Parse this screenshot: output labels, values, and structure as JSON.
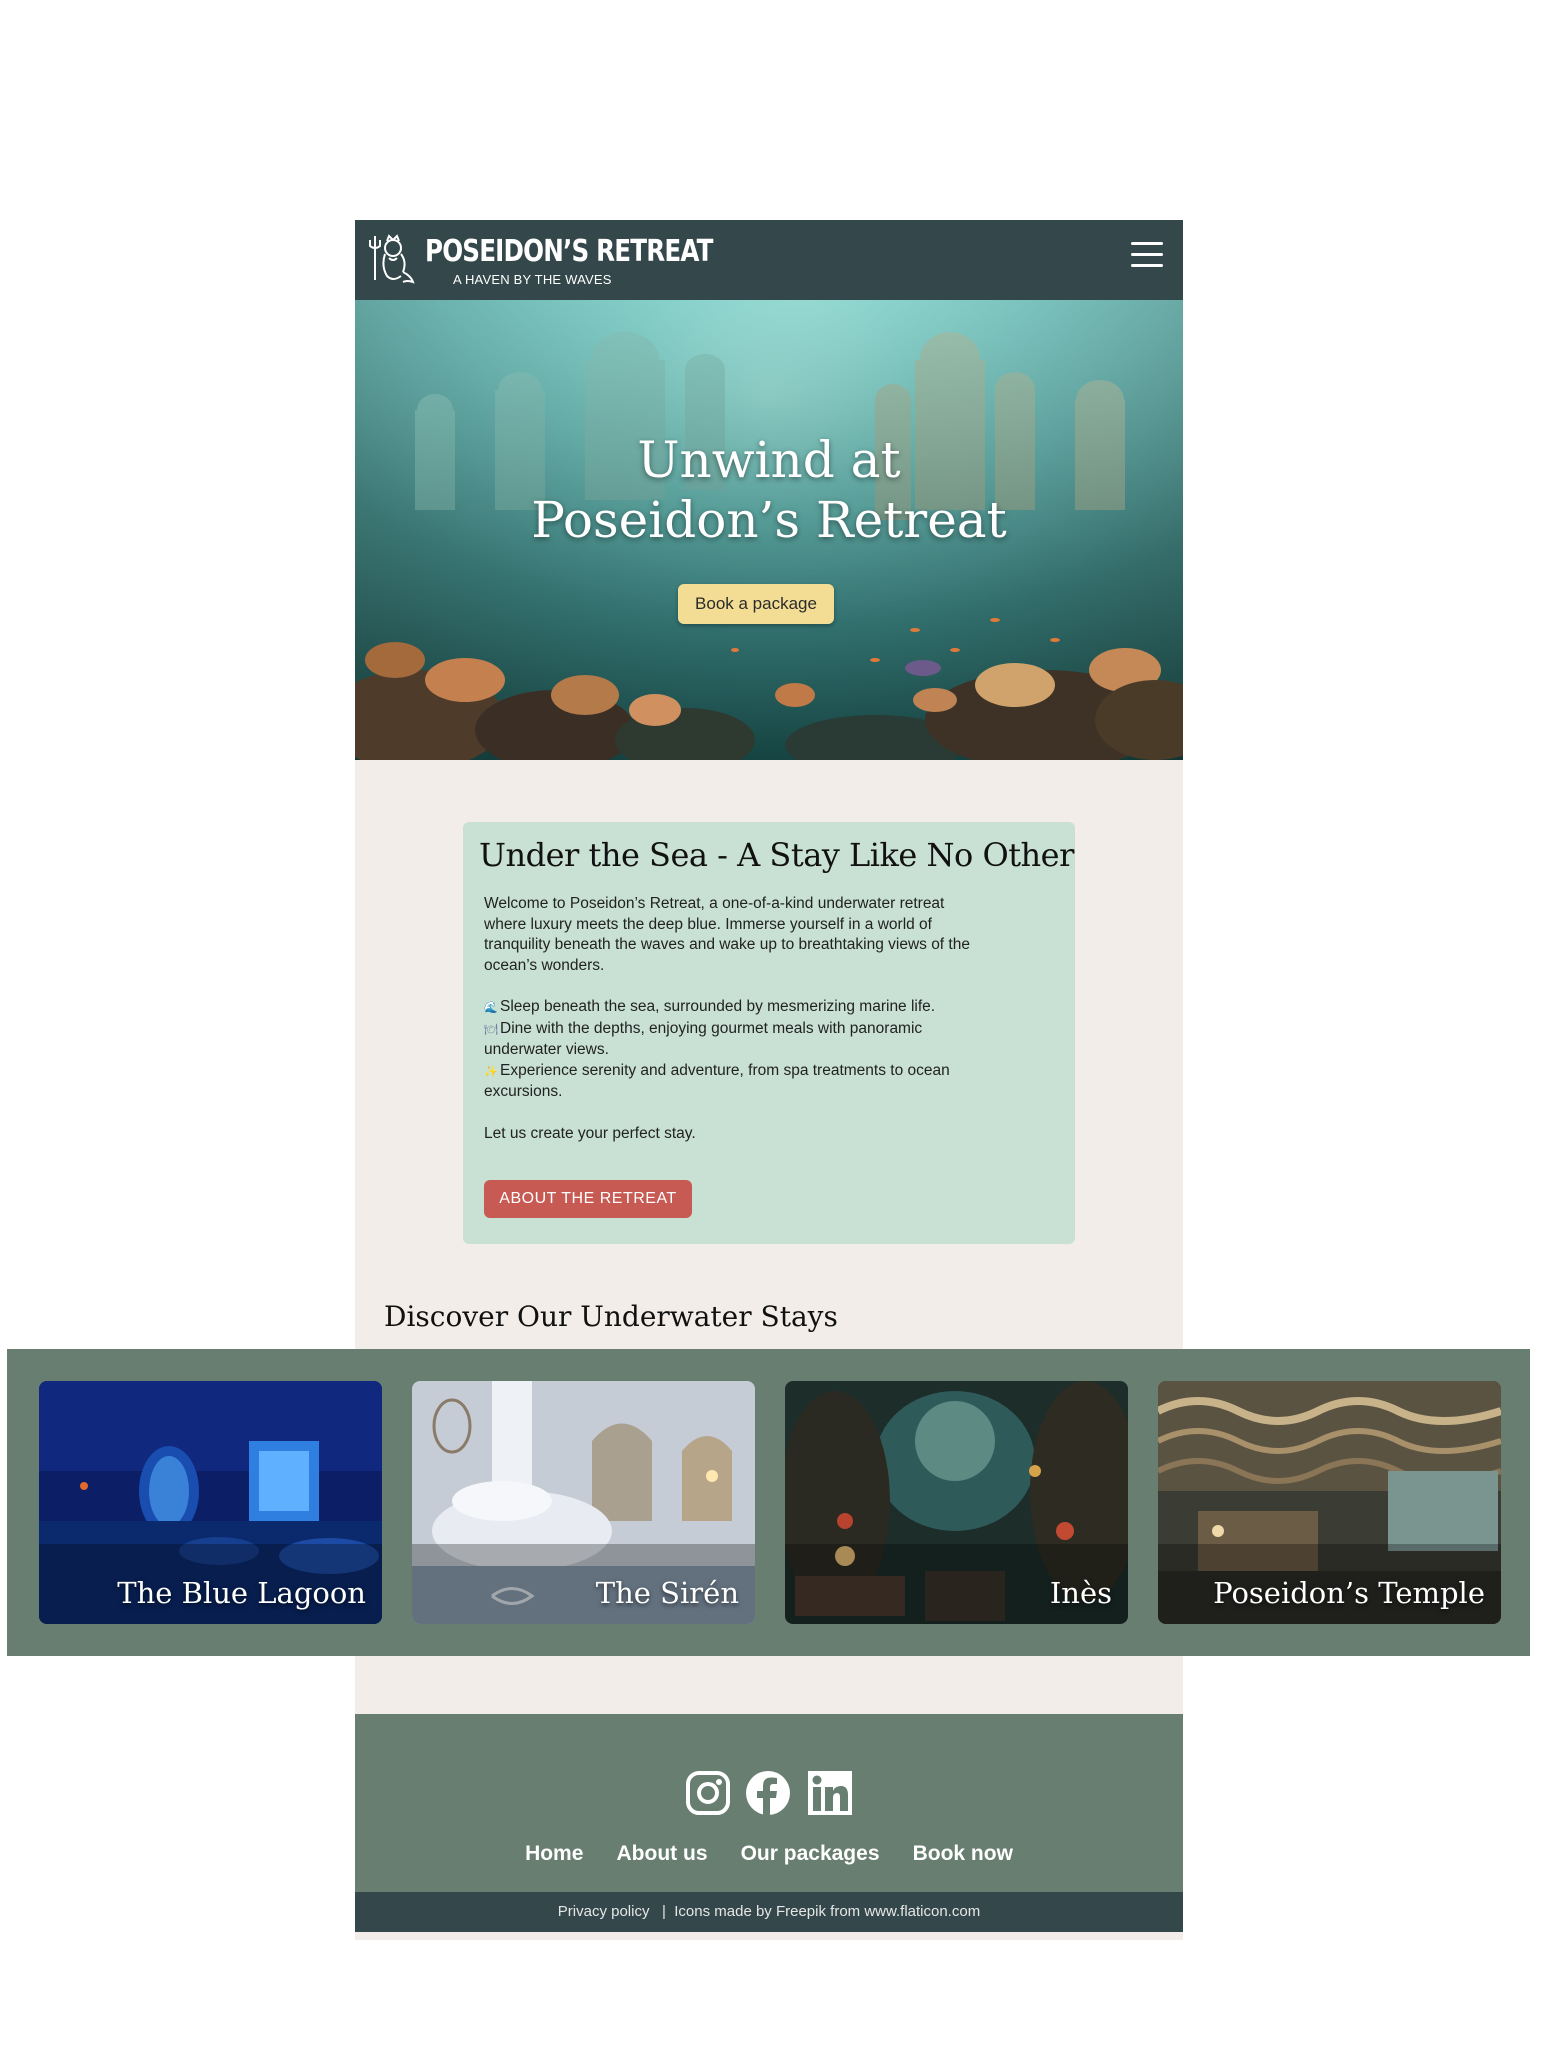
{
  "header": {
    "brand": "POSEIDON’S RETREAT",
    "tagline": "A HAVEN BY THE WAVES"
  },
  "hero": {
    "title_line1": "Unwind at",
    "title_line2": "Poseidon’s Retreat",
    "cta": "Book a package"
  },
  "intro": {
    "title": "Under the Sea - A Stay Like No Other",
    "paragraph": "Welcome to Poseidon’s Retreat, a one-of-a-kind underwater retreat where luxury meets the deep blue. Immerse yourself in a world of tranquility beneath the waves and wake up to breathtaking views of the ocean’s wonders.",
    "bullets": [
      "Sleep beneath the sea, surrounded by mesmerizing marine life.",
      "Dine with the depths, enjoying gourmet meals with panoramic underwater views.",
      "Experience serenity and adventure, from spa treatments to ocean excursions."
    ],
    "closing": "Let us create your perfect stay.",
    "button": "ABOUT THE RETREAT"
  },
  "stays": {
    "heading": "Discover Our Underwater Stays",
    "cards": [
      {
        "name": "The Blue Lagoon"
      },
      {
        "name": "The Sirén"
      },
      {
        "name": "Inès"
      },
      {
        "name": "Poseidon’s Temple"
      }
    ]
  },
  "footer": {
    "social": [
      "instagram-icon",
      "facebook-icon",
      "linkedin-icon"
    ],
    "links": [
      "Home",
      "About us",
      "Our packages",
      "Book now"
    ],
    "privacy": "Privacy policy",
    "separator": "|",
    "credit": "Icons made by Freepik from www.flaticon.com"
  },
  "colors": {
    "header_bg": "#34474a",
    "page_bg": "#f2ede8",
    "card_bg": "#c8e1d4",
    "accent_red": "#c75a52",
    "cta_yellow": "#f3dd95",
    "band_green": "#687e71"
  }
}
